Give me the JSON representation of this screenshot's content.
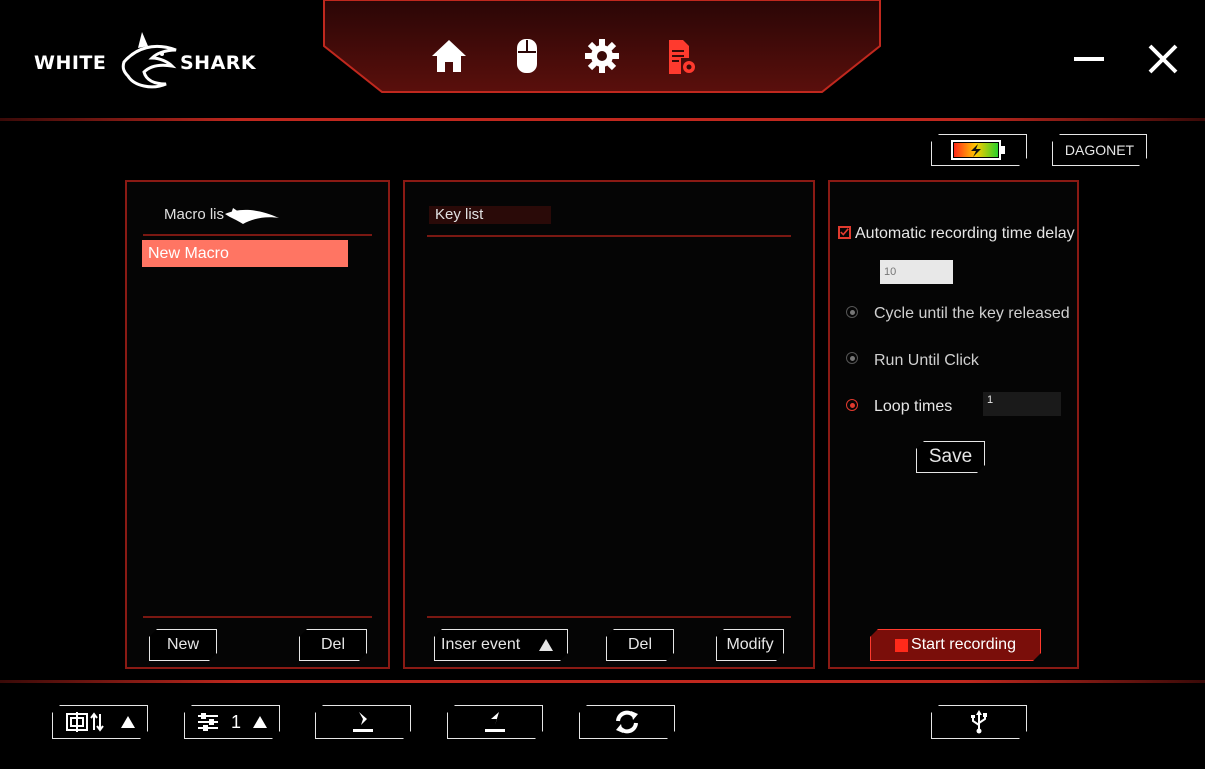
{
  "header": {
    "logo_left": "WHITE",
    "logo_right": "SHARK",
    "nav": [
      "home-icon",
      "mouse-icon",
      "gear-icon",
      "macro-file-icon"
    ],
    "accent": "#e8342a"
  },
  "status": {
    "profile": "DAGONET"
  },
  "macro_panel": {
    "title": "Macro lis",
    "items": [
      "New Macro"
    ],
    "new_label": "New",
    "del_label": "Del"
  },
  "key_panel": {
    "title": "Key list",
    "insert_label": "Inser event",
    "del_label": "Del",
    "modify_label": "Modify"
  },
  "record_panel": {
    "auto_delay_label": "Automatic recording time delay",
    "auto_delay_checked": true,
    "delay_value": "10",
    "cycle_label": "Cycle until the key released",
    "run_until_label": "Run Until Click",
    "loop_label": "Loop times",
    "loop_value": "1",
    "selected_mode": "loop",
    "save_label": "Save",
    "start_label": "Start recording"
  },
  "footer": {
    "profile_number": "1"
  }
}
